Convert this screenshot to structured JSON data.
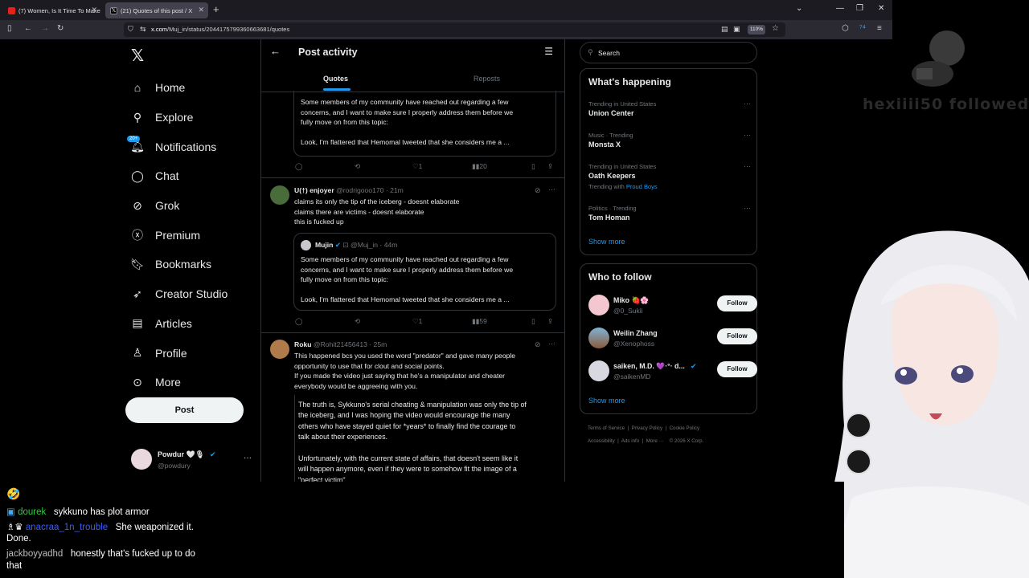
{
  "browser": {
    "tabs": [
      {
        "title": "(7) Women, Is It Time To Make ·"
      },
      {
        "title": "(21) Quotes of this post / X"
      }
    ],
    "url_host": "x.com",
    "url_path": "/Muj_in/status/2044175799360663681/quotes",
    "zoom": "110%"
  },
  "xnav": {
    "items": [
      {
        "label": "Home",
        "icon": "home-icon"
      },
      {
        "label": "Explore",
        "icon": "search-icon"
      },
      {
        "label": "Notifications",
        "icon": "bell-icon",
        "badge": "20+"
      },
      {
        "label": "Chat",
        "icon": "chat-icon"
      },
      {
        "label": "Grok",
        "icon": "grok-icon"
      },
      {
        "label": "Premium",
        "icon": "x-circle-icon"
      },
      {
        "label": "Bookmarks",
        "icon": "bookmark-icon"
      },
      {
        "label": "Creator Studio",
        "icon": "rocket-icon"
      },
      {
        "label": "Articles",
        "icon": "article-icon"
      },
      {
        "label": "Profile",
        "icon": "person-icon"
      },
      {
        "label": "More",
        "icon": "more-circle-icon"
      }
    ],
    "post_button": "Post",
    "account": {
      "name": "Powdur 🤍🎙",
      "handle": "@powdury"
    }
  },
  "main": {
    "title": "Post activity",
    "tabs": [
      "Quotes",
      "Reposts"
    ],
    "quote_top": {
      "lines": [
        "Some members of my community have reached out regarding a few",
        "concerns, and I want to make sure I properly address them before we",
        "fully move on from this topic:",
        "",
        "Look, I'm flattered that Hemomal tweeted that she considers me a ..."
      ],
      "actions": {
        "likes": "1",
        "views": "20"
      }
    },
    "post2": {
      "name": "U(†) enjoyer",
      "handle": "@rodrigooo170",
      "time": "· 21m",
      "lines": [
        "claims its only the tip of the iceberg - doesnt elaborate",
        "claims there are victims - doesnt elaborate",
        "this is fucked up"
      ],
      "quoted_name": "Mujin",
      "quoted_handle": "@Muj_in",
      "quoted_time": "· 44m",
      "quoted_lines": [
        "Some members of my community have reached out regarding a few",
        "concerns, and I want to make sure I properly address them before we",
        "fully move on from this topic:",
        "",
        "Look, I'm flattered that Hemomal tweeted that she considers me a ..."
      ],
      "actions": {
        "likes": "1",
        "views": "59"
      }
    },
    "post3": {
      "name": "Roku",
      "handle": "@Rohit21456413",
      "time": "· 25m",
      "lines": [
        "This happened bcs you used the word \"predator\" and gave many people",
        "opportunity to use that for clout and social points.",
        "If you made the video just saying that he's a manipulator and cheater",
        "everybody would be aggreeing with you."
      ],
      "quoted_lines": [
        "The truth is, Sykkuno's serial cheating & manipulation was only the tip of",
        "the iceberg, and I was hoping the video would encourage the many",
        "others who have stayed quiet for *years* to finally find the courage to",
        "talk about their experiences.",
        "",
        "Unfortunately, with the current state of affairs, that doesn't seem like it",
        "will happen anymore, even if they were to somehow fit the image of a",
        "\"perfect victim\""
      ]
    }
  },
  "sidebar": {
    "search_placeholder": "Search",
    "happening_title": "What's happening",
    "trends": [
      {
        "context": "Trending in United States",
        "title": "Union Center"
      },
      {
        "context": "Music · Trending",
        "title": "Monsta X"
      },
      {
        "context": "Trending in United States",
        "title": "Oath Keepers",
        "with_prefix": "Trending with",
        "with": "Proud Boys"
      },
      {
        "context": "Politics · Trending",
        "title": "Tom Homan"
      }
    ],
    "show_more": "Show more",
    "wtf_title": "Who to follow",
    "follow_suggestions": [
      {
        "name": "Miko 🍓🌸",
        "handle": "@0_Sukii"
      },
      {
        "name": "Weilin Zhang",
        "handle": "@Xenophoss"
      },
      {
        "name": "saiken, M.D. 💜·°· d...",
        "handle": "@saikenMD"
      }
    ],
    "follow_label": "Follow",
    "footer": [
      "Terms of Service",
      "Privacy Policy",
      "Cookie Policy",
      "Accessibility",
      "Ads info",
      "More ···",
      "© 2026 X Corp."
    ]
  },
  "overlay": {
    "follow_alert": "hexiiii50 followed!"
  },
  "chat": [
    {
      "user": "",
      "message": "🤣"
    },
    {
      "user": "dourek",
      "message": "sykkuno has plot armor"
    },
    {
      "user": "anacraa_1n_trouble",
      "message": "She weaponized it."
    },
    {
      "user": "",
      "message": "Done."
    },
    {
      "user": "jackboyyadhd",
      "message": "honestly that's fucked up to do"
    },
    {
      "user": "",
      "message": "that"
    }
  ],
  "colors": {
    "accent": "#1d9bf0",
    "background": "#000000",
    "border": "#2f3336",
    "muted": "#71767b"
  }
}
